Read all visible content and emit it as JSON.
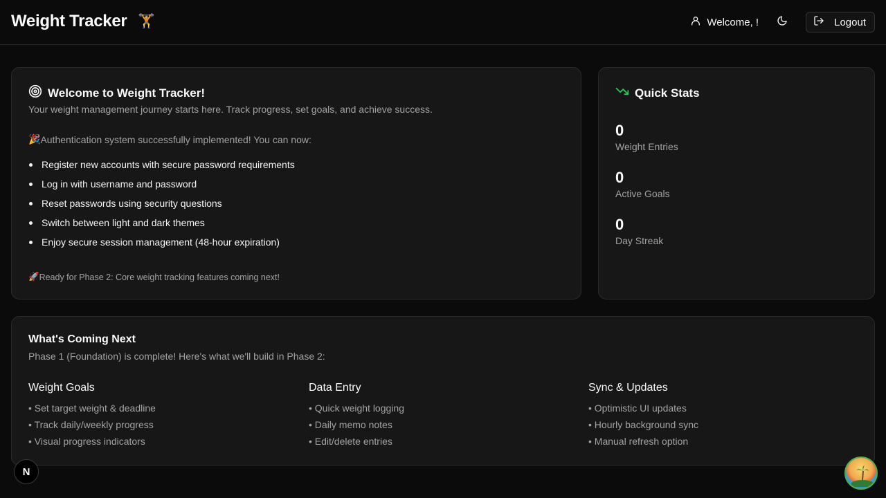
{
  "header": {
    "app_title": "Weight Tracker",
    "app_emoji": "🏋️",
    "welcome_text": "Welcome, !",
    "logout_label": "Logout"
  },
  "welcome_card": {
    "title": "Welcome to Weight Tracker!",
    "description": "Your weight management journey starts here. Track progress, set goals, and achieve success.",
    "auth_emoji": "🎉",
    "auth_text": "Authentication system successfully implemented! You can now:",
    "features": [
      "Register new accounts with secure password requirements",
      "Log in with username and password",
      "Reset passwords using security questions",
      "Switch between light and dark themes",
      "Enjoy secure session management (48-hour expiration)"
    ],
    "phase_emoji": "🚀",
    "phase_text": "Ready for Phase 2: Core weight tracking features coming next!"
  },
  "stats_card": {
    "title": "Quick Stats",
    "stats": [
      {
        "value": "0",
        "label": "Weight Entries"
      },
      {
        "value": "0",
        "label": "Active Goals"
      },
      {
        "value": "0",
        "label": "Day Streak"
      }
    ]
  },
  "next_card": {
    "title": "What's Coming Next",
    "description": "Phase 1 (Foundation) is complete! Here's what we'll build in Phase 2:",
    "columns": [
      {
        "title": "Weight Goals",
        "items": [
          "• Set target weight & deadline",
          "• Track daily/weekly progress",
          "• Visual progress indicators"
        ]
      },
      {
        "title": "Data Entry",
        "items": [
          "• Quick weight logging",
          "• Daily memo notes",
          "• Edit/delete entries"
        ]
      },
      {
        "title": "Sync & Updates",
        "items": [
          "• Optimistic UI updates",
          "• Hourly background sync",
          "• Manual refresh option"
        ]
      }
    ]
  },
  "dev_badge": {
    "label": "N"
  },
  "colors": {
    "background": "#0b0b0b",
    "card": "#171717",
    "border": "#2a2a2a",
    "muted_text": "#a3a3a3",
    "trend_green": "#22c55e"
  },
  "icons": {
    "user": "user-icon",
    "theme": "moon-icon",
    "logout": "logout-icon",
    "target": "target-icon",
    "trend": "trending-down-icon"
  }
}
